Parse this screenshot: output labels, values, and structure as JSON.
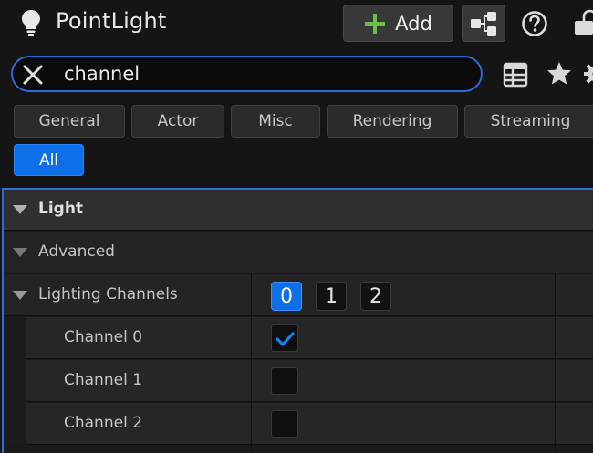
{
  "header": {
    "title": "PointLight",
    "add_label": "Add"
  },
  "search": {
    "value": "channel"
  },
  "filter_tabs": [
    {
      "label": "General",
      "active": false
    },
    {
      "label": "Actor",
      "active": false
    },
    {
      "label": "Misc",
      "active": false
    },
    {
      "label": "Rendering",
      "active": false
    },
    {
      "label": "Streaming",
      "active": false
    },
    {
      "label": "All",
      "active": true
    }
  ],
  "properties": {
    "light_section": "Light",
    "advanced_section": "Advanced",
    "lighting_channels": {
      "label": "Lighting Channels",
      "buttons": [
        {
          "label": "0",
          "on": true
        },
        {
          "label": "1",
          "on": false
        },
        {
          "label": "2",
          "on": false
        }
      ]
    },
    "channels": [
      {
        "label": "Channel 0",
        "checked": true
      },
      {
        "label": "Channel 1",
        "checked": false
      },
      {
        "label": "Channel 2",
        "checked": false
      }
    ]
  },
  "colors": {
    "accent": "#0d70e8",
    "focus_border": "#2f6bd8",
    "add_plus": "#6cc04a",
    "checkmark": "#1a7df0"
  },
  "icons": {
    "title": "lightbulb-icon",
    "add": "plus-icon",
    "blueprint": "blueprint-nodes-icon",
    "help": "help-icon",
    "lock": "lock-icon",
    "clear_search": "close-icon",
    "table_view": "grid-icon",
    "favorites": "star-icon",
    "settings": "gear-icon",
    "expand": "triangle-down-icon",
    "check": "checkmark-icon"
  }
}
